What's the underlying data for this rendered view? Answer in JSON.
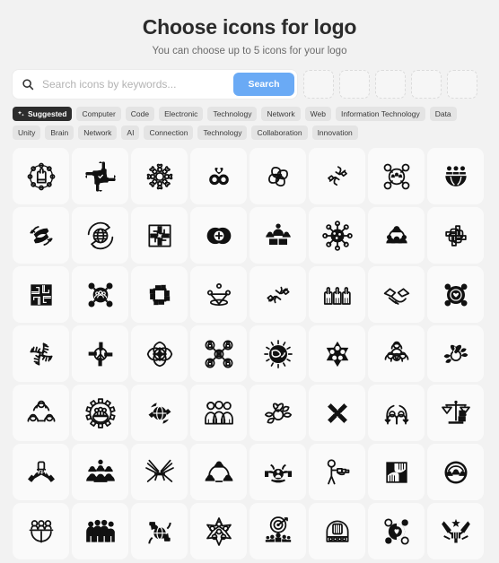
{
  "header": {
    "title": "Choose icons for logo",
    "subtitle": "You can choose up to 5 icons for your logo"
  },
  "search": {
    "placeholder": "Search icons by keywords...",
    "value": "",
    "button_label": "Search",
    "icon": "search-icon",
    "selected_slots": 5,
    "slots_filled": 0
  },
  "tags": [
    {
      "label": "Suggested",
      "selected": true,
      "icon": "sparkle-icon"
    },
    {
      "label": "Computer",
      "selected": false
    },
    {
      "label": "Code",
      "selected": false
    },
    {
      "label": "Electronic",
      "selected": false
    },
    {
      "label": "Technology",
      "selected": false
    },
    {
      "label": "Network",
      "selected": false
    },
    {
      "label": "Web",
      "selected": false
    },
    {
      "label": "Information Technology",
      "selected": false
    },
    {
      "label": "Data",
      "selected": false
    },
    {
      "label": "Unity",
      "selected": false
    },
    {
      "label": "Brain",
      "selected": false
    },
    {
      "label": "Network",
      "selected": false
    },
    {
      "label": "AI",
      "selected": false
    },
    {
      "label": "Connection",
      "selected": false
    },
    {
      "label": "Technology",
      "selected": false
    },
    {
      "label": "Collaboration",
      "selected": false
    },
    {
      "label": "Innovation",
      "selected": false
    }
  ],
  "colors": {
    "page_background": "#f2f2f2",
    "card_background": "#fafafa",
    "accent_button": "#6aaaf5",
    "chip_background": "#e4e4e4",
    "chip_selected_background": "#2d2d2d",
    "title_text": "#2b2b2b",
    "subtitle_text": "#6b6b6b",
    "placeholder_text": "#b3b3b3"
  },
  "grid": {
    "columns": 8,
    "rows_visible": 7,
    "icons": [
      {
        "name": "hand-in-circle-of-dots-icon",
        "style": "outline"
      },
      {
        "name": "four-hands-shield-rotation-icon",
        "style": "solid"
      },
      {
        "name": "eight-hands-hearts-star-icon",
        "style": "outline"
      },
      {
        "name": "three-circles-heart-icon",
        "style": "solid"
      },
      {
        "name": "four-arms-heart-pinwheel-icon",
        "style": "outline"
      },
      {
        "name": "two-hands-reaching-icon",
        "style": "outline"
      },
      {
        "name": "group-in-circle-network-icon",
        "style": "outline"
      },
      {
        "name": "three-people-bowl-icon",
        "style": "solid"
      },
      {
        "name": "two-hands-cycle-arrows-icon",
        "style": "solid"
      },
      {
        "name": "globe-recycle-arrows-icon",
        "style": "outline"
      },
      {
        "name": "four-hands-square-frame-icon",
        "style": "outline"
      },
      {
        "name": "two-overlapping-circles-plus-icon",
        "style": "solid"
      },
      {
        "name": "person-with-crowd-icon",
        "style": "solid"
      },
      {
        "name": "virus-network-node-icon",
        "style": "solid"
      },
      {
        "name": "leader-with-team-icon",
        "style": "solid"
      },
      {
        "name": "four-arms-square-link-icon",
        "style": "outline"
      },
      {
        "name": "four-hands-solid-square-icon",
        "style": "solid"
      },
      {
        "name": "group-circle-nodes-icon",
        "style": "solid"
      },
      {
        "name": "four-arms-open-square-icon",
        "style": "solid"
      },
      {
        "name": "people-funnel-location-icon",
        "style": "outline"
      },
      {
        "name": "two-arms-hand-shake-icon",
        "style": "solid"
      },
      {
        "name": "three-raised-hands-icon",
        "style": "outline"
      },
      {
        "name": "handshake-icon",
        "style": "outline"
      },
      {
        "name": "heart-circle-nodes-icon",
        "style": "solid"
      },
      {
        "name": "four-hands-pinwheel-outline-icon",
        "style": "outline"
      },
      {
        "name": "four-hands-peace-sign-icon",
        "style": "solid"
      },
      {
        "name": "ornamental-network-star-icon",
        "style": "outline"
      },
      {
        "name": "lock-nodes-network-icon",
        "style": "outline"
      },
      {
        "name": "sun-globe-rays-icon",
        "style": "solid"
      },
      {
        "name": "six-point-star-dots-icon",
        "style": "solid"
      },
      {
        "name": "three-people-group-icon",
        "style": "outline"
      },
      {
        "name": "heart-laurel-wreath-icon",
        "style": "solid"
      },
      {
        "name": "three-people-connected-icon",
        "style": "outline"
      },
      {
        "name": "gear-with-team-icon",
        "style": "outline"
      },
      {
        "name": "globe-hands-arrows-icon",
        "style": "solid"
      },
      {
        "name": "three-people-linked-arms-icon",
        "style": "outline"
      },
      {
        "name": "heart-laurel-ribbon-icon",
        "style": "outline"
      },
      {
        "name": "four-hands-hearts-cross-icon",
        "style": "solid"
      },
      {
        "name": "two-people-arch-support-icon",
        "style": "outline"
      },
      {
        "name": "scales-justice-fist-icon",
        "style": "solid"
      },
      {
        "name": "fist-bump-icon",
        "style": "solid"
      },
      {
        "name": "crowd-of-people-icon",
        "style": "solid"
      },
      {
        "name": "crossed-hands-burst-icon",
        "style": "outline"
      },
      {
        "name": "three-people-network-arc-icon",
        "style": "solid"
      },
      {
        "name": "hands-holding-person-icon",
        "style": "solid"
      },
      {
        "name": "person-giving-handshake-icon",
        "style": "outline"
      },
      {
        "name": "two-hands-solid-square-icon",
        "style": "solid"
      },
      {
        "name": "group-in-circle-arc-icon",
        "style": "solid"
      },
      {
        "name": "three-people-bowl-outline-icon",
        "style": "outline"
      },
      {
        "name": "four-people-linked-icon",
        "style": "solid"
      },
      {
        "name": "hands-holding-globe-icon",
        "style": "solid"
      },
      {
        "name": "star-network-nodes-icon",
        "style": "outline"
      },
      {
        "name": "target-with-audience-icon",
        "style": "solid"
      },
      {
        "name": "fist-in-circle-icon",
        "style": "outline"
      },
      {
        "name": "heart-circle-four-nodes-icon",
        "style": "solid"
      },
      {
        "name": "victory-hands-star-icon",
        "style": "solid"
      }
    ]
  }
}
